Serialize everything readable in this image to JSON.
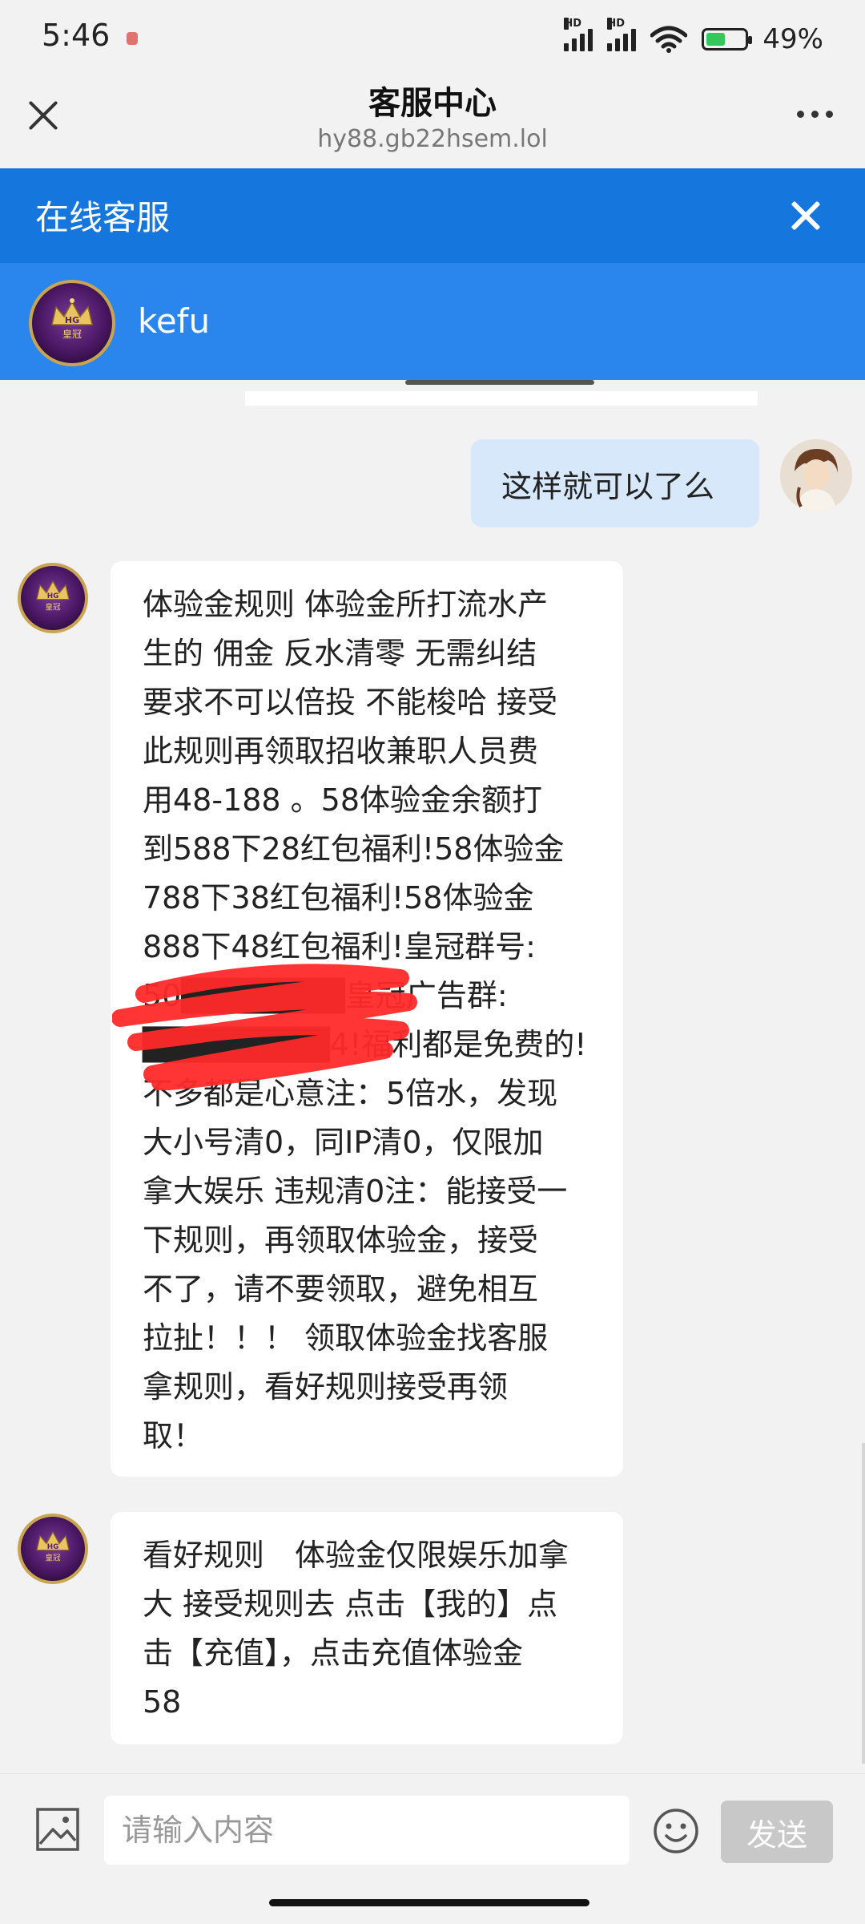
{
  "status_bar": {
    "time": "5:46",
    "hd_label": "HD",
    "battery_percent": "49%",
    "battery_level": 0.49
  },
  "browser": {
    "title": "客服中心",
    "url": "hy88.gb22hsem.lol"
  },
  "chat_header": {
    "title": "在线客服",
    "agent_name": "kefu",
    "avatar_text": "皇冠",
    "avatar_badge": "HG"
  },
  "messages": [
    {
      "from": "user",
      "text": "这样就可以了么"
    },
    {
      "from": "agent",
      "lines": [
        "体验金规则 体验金所打流水产",
        "生的 佣金 反水清零 无需纠结",
        "要求不可以倍投 不能梭哈 接受",
        "此规则再领取招收兼职人员费",
        "用48-188 。58体验金余额打",
        "到588下28红包福利!58体验金",
        "788下38红包福利!58体验金",
        "888下48红包福利!皇冠群号:",
        "50███████皇冠广告群:",
        "████████4!福利都是免费的!",
        "不多都是心意注：5倍水，发现",
        "大小号清0，同IP清0，仅限加",
        "拿大娱乐 违规清0注：能接受一",
        "下规则，再领取体验金，接受",
        "不了，请不要领取，避免相互",
        "拉扯！！！ 领取体验金找客服",
        "拿规则，看好规则接受再领",
        "取！"
      ]
    },
    {
      "from": "agent",
      "lines": [
        "看好规则　体验金仅限娱乐加拿",
        "大  接受规则去 点击【我的】点",
        "击【充值】，点击充值体验金",
        "58"
      ]
    }
  ],
  "input": {
    "placeholder": "请输入内容",
    "send_label": "发送"
  },
  "icons": {
    "close": "close-icon",
    "more": "more-icon",
    "image": "image-icon",
    "emoji": "emoji-icon"
  },
  "colors": {
    "chat_header": "#1577dd",
    "agent_bar": "#2a86ec",
    "user_bubble": "#d7e8fb",
    "scribble": "#ff2a2a",
    "send_disabled": "#c8c8c8"
  }
}
